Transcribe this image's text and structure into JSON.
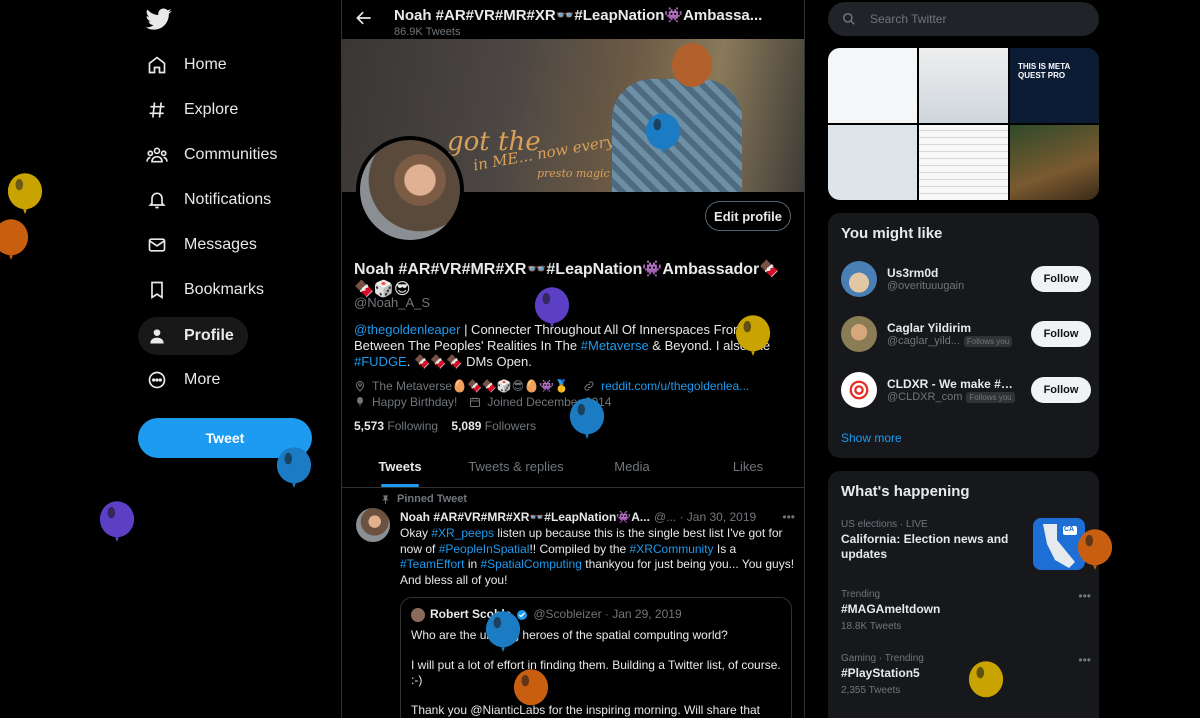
{
  "nav": {
    "items": [
      {
        "label": "Home",
        "icon": "home-icon"
      },
      {
        "label": "Explore",
        "icon": "hashtag-icon"
      },
      {
        "label": "Communities",
        "icon": "communities-icon"
      },
      {
        "label": "Notifications",
        "icon": "bell-icon"
      },
      {
        "label": "Messages",
        "icon": "envelope-icon"
      },
      {
        "label": "Bookmarks",
        "icon": "bookmark-icon"
      },
      {
        "label": "Profile",
        "icon": "person-icon"
      },
      {
        "label": "More",
        "icon": "more-circle-icon"
      }
    ],
    "tweet_label": "Tweet"
  },
  "profile": {
    "header_title": "Noah #AR#VR#MR#XR👓#LeapNation👾Ambassa...",
    "header_sub": "86.9K Tweets",
    "edit_label": "Edit profile",
    "name": "Noah #AR#VR#MR#XR👓#LeapNation👾Ambassador🍫🍫🎲😎",
    "handle": "@Noah_A_S",
    "bio_mention": "@thegoldenleaper",
    "bio_text_1": " | Connecter Throughout All Of Innerspaces From Between The Peoples' Realities In The ",
    "bio_tag_1": "#Metaverse",
    "bio_text_2": " & Beyond. I also like ",
    "bio_tag_2": "#FUDGE",
    "bio_text_3": ". 🍫🍫🍫 DMs Open.",
    "location": "The Metaverse🥚🍫🍫🎲😎🥚👾🥇",
    "url": "reddit.com/u/thegoldenlea...",
    "birthday": "Happy Birthday!",
    "joined": "Joined December 2014",
    "following_count": "5,573",
    "following_label": "Following",
    "followers_count": "5,089",
    "followers_label": "Followers",
    "tabs": [
      "Tweets",
      "Tweets & replies",
      "Media",
      "Likes"
    ],
    "banner_text_1": "got the",
    "banner_text_2": "in ME... now everybody",
    "banner_text_3": "presto magic"
  },
  "pinned": {
    "label": "Pinned Tweet",
    "author": "Noah #AR#VR#MR#XR👓#LeapNation👾A...",
    "meta": "@... · Jan 30, 2019",
    "text_1": "Okay ",
    "tag_1": "#XR_peeps",
    "text_2": " listen up because this is the single best list I've got for now of ",
    "tag_2": "#PeopleInSpatial",
    "text_3": "!! Compiled by the ",
    "tag_3": "#XRCommunity",
    "text_4": " Is a ",
    "tag_4": "#TeamEffort",
    "text_5": " in ",
    "tag_5": "#SpatialComputing",
    "text_6": " thankyou for just being you... You guys! And bless all of you!",
    "quote": {
      "author": "Robert Scoble",
      "meta": "@Scobleizer · Jan 29, 2019",
      "line_1": "Who are the unsung heroes of the spatial computing world?",
      "line_2": "I will put a lot of effort in finding them. Building a Twitter list, of course. :-)",
      "line_3": "Thank you @NianticLabs for the inspiring morning. Will share that with"
    }
  },
  "right": {
    "search_placeholder": "Search Twitter",
    "media_caption": "THIS IS META QUEST PRO",
    "wtf_title": "You might like",
    "suggestions": [
      {
        "name": "Us3rm0d",
        "handle": "@overituuugain",
        "follows_you": "",
        "color": "#4a7fb5"
      },
      {
        "name": "Caglar Yildirim",
        "handle": "@caglar_yild...",
        "follows_you": "Follows you",
        "color": "#8a7d55"
      },
      {
        "name": "CLDXR - We make #X...",
        "handle": "@CLDXR_com",
        "follows_you": "Follows you",
        "color": "#ffffff"
      }
    ],
    "follow_label": "Follow",
    "show_more": "Show more",
    "trends_title": "What's happening",
    "trends": [
      {
        "context": "US elections · LIVE",
        "title": "California: Election news and updates",
        "count": ""
      },
      {
        "context": "Trending",
        "title": "#MAGAmeltdown",
        "count": "18.8K Tweets"
      },
      {
        "context": "Gaming · Trending",
        "title": "#PlayStation5",
        "count": "2,355 Tweets"
      }
    ],
    "trend_badge": "CA"
  },
  "colors": {
    "accent": "#1d9bf0",
    "background": "#000000",
    "card": "#16181c"
  }
}
